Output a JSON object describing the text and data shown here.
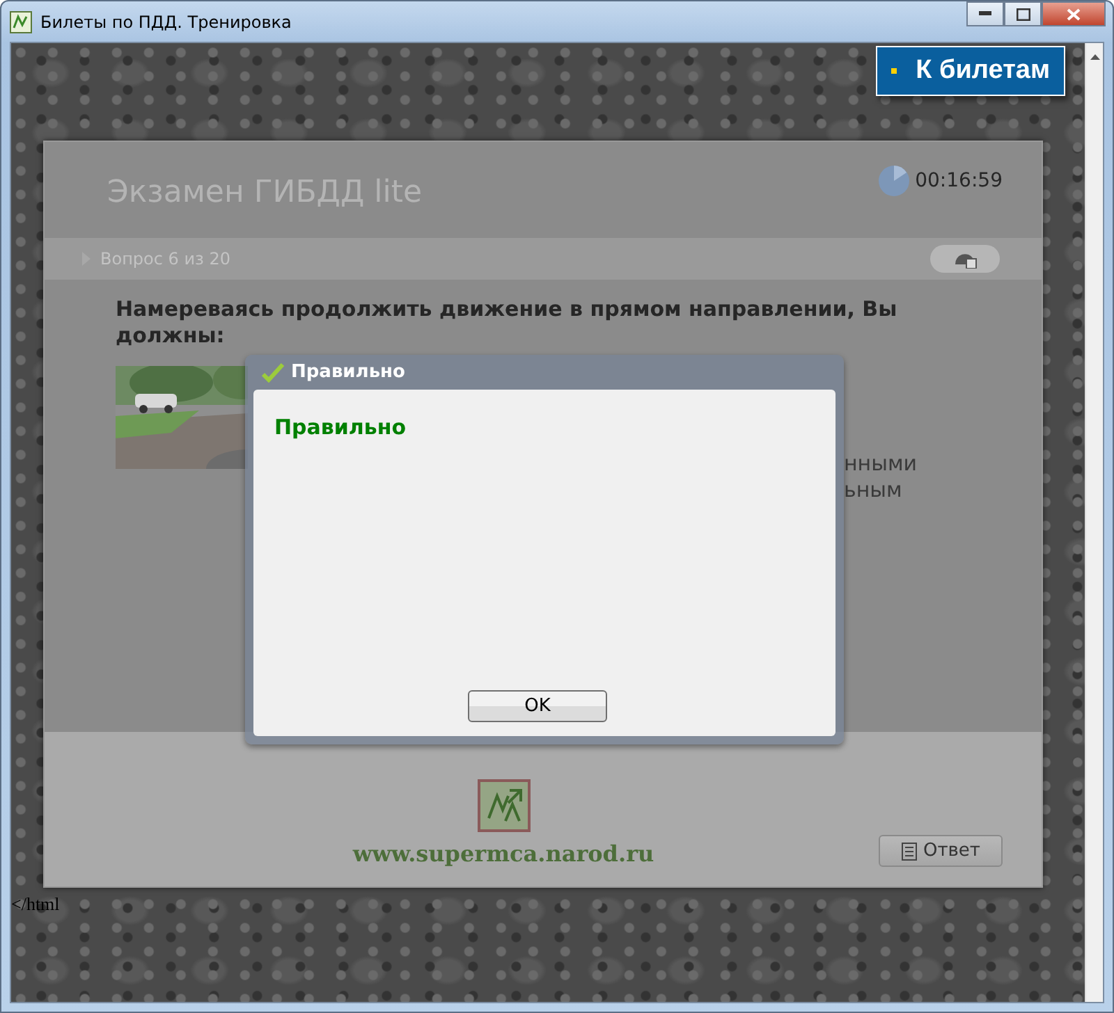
{
  "window": {
    "title": "Билеты по ПДД. Тренировка"
  },
  "nav_button": {
    "label": "К билетам"
  },
  "exam": {
    "title": "Экзамен ГИБДД lite",
    "timer": "00:16:59",
    "progress": "Вопрос 6 из 20",
    "question": "Намереваясь продолжить движение в прямом направлении, Вы должны:",
    "answer_visible_fragments": [
      "нными",
      "ьным"
    ],
    "site_link": "www.supermca.narod.ru",
    "answer_button": "Ответ"
  },
  "page_footer": "</html",
  "dialog": {
    "title": "Правильно",
    "message": "Правильно",
    "button": "OK"
  }
}
